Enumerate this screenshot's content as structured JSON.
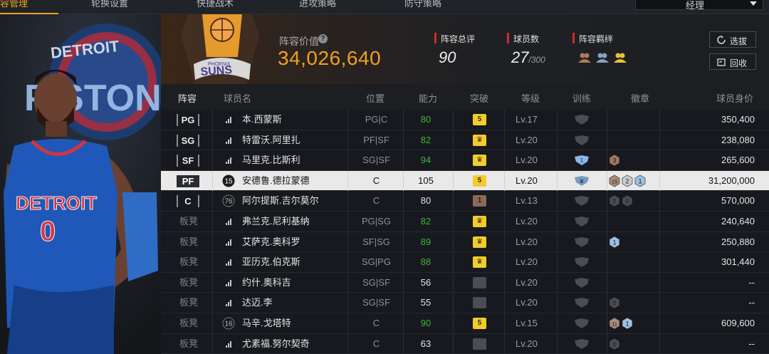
{
  "nav": {
    "tabs": [
      {
        "label": "容管理",
        "active": true
      },
      {
        "label": "轮换设置",
        "active": false
      },
      {
        "label": "快捷战术",
        "active": false
      },
      {
        "label": "进攻策略",
        "active": false
      },
      {
        "label": "防守策略",
        "active": false
      }
    ],
    "manager_select": "经理"
  },
  "header": {
    "value_label": "阵容价值",
    "value": "34,026,640",
    "overall_label": "阵容总评",
    "overall": "90",
    "players_label": "球员数",
    "players": "27",
    "players_max": "/300",
    "bond_label": "阵容羁绊",
    "draft_button": "选拔",
    "recycle_button": "回收"
  },
  "table": {
    "headers": {
      "lineup": "阵容",
      "name": "球员名",
      "position": "位置",
      "ability": "能力",
      "breakthrough": "突破",
      "level": "等级",
      "training": "训练",
      "badges": "徽章",
      "worth": "球员身价"
    },
    "rows": [
      {
        "slot": "PG",
        "starter": true,
        "jersey": "",
        "name": "本.西蒙斯",
        "pos": "PG|C",
        "ability": "80",
        "ability_color": "green",
        "brk": "5",
        "brk_style": "gold",
        "level": "Lv.17",
        "train": "",
        "badges": [],
        "worth": "350,400",
        "selected": false
      },
      {
        "slot": "SG",
        "starter": true,
        "jersey": "",
        "name": "特雷沃.阿里扎",
        "pos": "PF|SF",
        "ability": "82",
        "ability_color": "green",
        "brk": "♛",
        "brk_style": "gold",
        "level": "Lv.20",
        "train": "",
        "badges": [],
        "worth": "238,080",
        "selected": false
      },
      {
        "slot": "SF",
        "starter": true,
        "jersey": "",
        "name": "马里克.比斯利",
        "pos": "SG|SF",
        "ability": "94",
        "ability_color": "green",
        "brk": "♛",
        "brk_style": "gold",
        "level": "Lv.20",
        "train": "1",
        "badges": [
          "3"
        ],
        "worth": "265,600",
        "selected": false
      },
      {
        "slot": "PF",
        "starter": true,
        "jersey": "15",
        "name": "安德鲁.德拉蒙德",
        "pos": "C",
        "ability": "105",
        "ability_color": "white",
        "brk": "5",
        "brk_style": "gold",
        "level": "Lv.20",
        "train": "♛",
        "badges": [
          "15",
          "2",
          "1"
        ],
        "worth": "31,200,000",
        "selected": true
      },
      {
        "slot": "C",
        "starter": true,
        "jersey": "76",
        "name": "阿尔提斯.吉尔莫尔",
        "pos": "C",
        "ability": "80",
        "ability_color": "white",
        "brk": "1",
        "brk_style": "brown",
        "level": "Lv.13",
        "train": "",
        "badges": [
          "0",
          "0"
        ],
        "worth": "570,000",
        "selected": false
      },
      {
        "slot": "板凳",
        "starter": false,
        "jersey": "",
        "name": "弗兰克.尼利基纳",
        "pos": "PG|SG",
        "ability": "82",
        "ability_color": "green",
        "brk": "♛",
        "brk_style": "gold",
        "level": "Lv.20",
        "train": "",
        "badges": [],
        "worth": "240,640",
        "selected": false
      },
      {
        "slot": "板凳",
        "starter": false,
        "jersey": "",
        "name": "艾萨克.奥科罗",
        "pos": "SF|SG",
        "ability": "89",
        "ability_color": "green",
        "brk": "♛",
        "brk_style": "gold",
        "level": "Lv.20",
        "train": "",
        "badges": [
          "1"
        ],
        "worth": "250,880",
        "selected": false
      },
      {
        "slot": "板凳",
        "starter": false,
        "jersey": "",
        "name": "亚历克.伯克斯",
        "pos": "SG|PG",
        "ability": "88",
        "ability_color": "green",
        "brk": "♛",
        "brk_style": "gold",
        "level": "Lv.20",
        "train": "",
        "badges": [],
        "worth": "301,440",
        "selected": false
      },
      {
        "slot": "板凳",
        "starter": false,
        "jersey": "",
        "name": "约什.奥科吉",
        "pos": "SG|SF",
        "ability": "56",
        "ability_color": "white",
        "brk": "",
        "brk_style": "gray",
        "level": "Lv.20",
        "train": "",
        "badges": [],
        "worth": "--",
        "selected": false
      },
      {
        "slot": "板凳",
        "starter": false,
        "jersey": "",
        "name": "达迈.李",
        "pos": "SG|SF",
        "ability": "55",
        "ability_color": "white",
        "brk": "",
        "brk_style": "gray",
        "level": "Lv.20",
        "train": "",
        "badges": [
          "0"
        ],
        "worth": "--",
        "selected": false
      },
      {
        "slot": "板凳",
        "starter": false,
        "jersey": "16",
        "name": "马辛.戈塔特",
        "pos": "C",
        "ability": "90",
        "ability_color": "green",
        "brk": "5",
        "brk_style": "gold",
        "level": "Lv.15",
        "train": "",
        "badges": [
          "11",
          "1"
        ],
        "worth": "609,600",
        "selected": false
      },
      {
        "slot": "板凳",
        "starter": false,
        "jersey": "",
        "name": "尤素福.努尔契奇",
        "pos": "C",
        "ability": "63",
        "ability_color": "white",
        "brk": "",
        "brk_style": "gray",
        "level": "Lv.20",
        "train": "",
        "badges": [
          "0"
        ],
        "worth": "--",
        "selected": false
      }
    ]
  },
  "colors": {
    "accent": "#f0a020",
    "green": "#3fb33a",
    "red_bar": "#d22a2a",
    "gold_badge": "#f2cc2d"
  }
}
